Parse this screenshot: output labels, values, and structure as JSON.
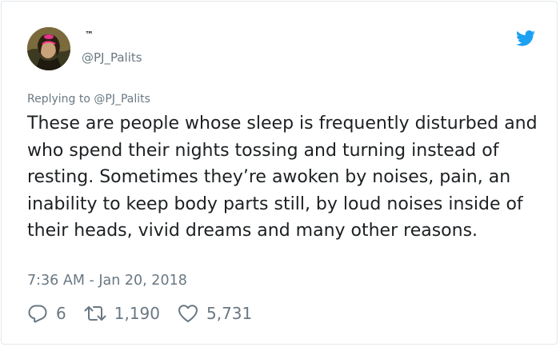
{
  "author": {
    "display_name": "™",
    "handle": "@PJ_Palits"
  },
  "reply_context": "Replying to @PJ_Palits",
  "tweet": {
    "text": "These are people whose sleep is frequently disturbed and who spend their nights tossing and turning instead of resting. Sometimes they’re awoken by noises, pain, an inability to keep body parts still, by loud noises inside of their heads, vivid dreams and many other reasons.",
    "timestamp": "7:36 AM - Jan 20, 2018"
  },
  "actions": {
    "reply_count": "6",
    "retweet_count": "1,190",
    "like_count": "5,731"
  },
  "icons": {
    "brand": "twitter-bird-icon",
    "reply": "reply-icon",
    "retweet": "retweet-icon",
    "like": "heart-icon"
  },
  "colors": {
    "brand_blue": "#1da1f2",
    "muted_text": "#697882",
    "body_text": "#1c2022",
    "border": "#e1e8ed"
  }
}
